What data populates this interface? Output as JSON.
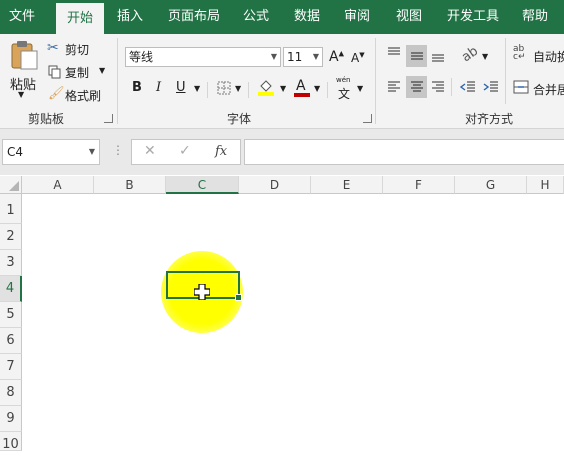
{
  "tabs": [
    "文件",
    "开始",
    "插入",
    "页面布局",
    "公式",
    "数据",
    "审阅",
    "视图",
    "开发工具",
    "帮助"
  ],
  "active_tab": "开始",
  "clipboard": {
    "paste_label": "粘贴",
    "cut_label": "剪切",
    "copy_label": "复制",
    "format_painter_label": "格式刷",
    "group_label": "剪贴板"
  },
  "font": {
    "font_name": "等线",
    "font_size": "11",
    "bold": "B",
    "italic": "I",
    "underline": "U",
    "font_color_glyph": "A",
    "phonetic_glyph": "文",
    "group_label": "字体"
  },
  "alignment": {
    "wrap_text_label": "自动换",
    "merge_label": "合并居",
    "group_label": "对齐方式"
  },
  "formula_bar": {
    "name_box": "C4",
    "cancel": "✕",
    "enter": "✓",
    "fx": "fx",
    "formula": ""
  },
  "columns": [
    "A",
    "B",
    "C",
    "D",
    "E",
    "F",
    "G",
    "H"
  ],
  "rows": [
    "1",
    "2",
    "3",
    "4",
    "5",
    "6",
    "7",
    "8",
    "9",
    "10"
  ],
  "selected_cell": "C4",
  "colors": {
    "accent": "#217346",
    "highlight": "#ffff00",
    "fill_bucket": "#ffff00",
    "font_color": "#c00000"
  }
}
